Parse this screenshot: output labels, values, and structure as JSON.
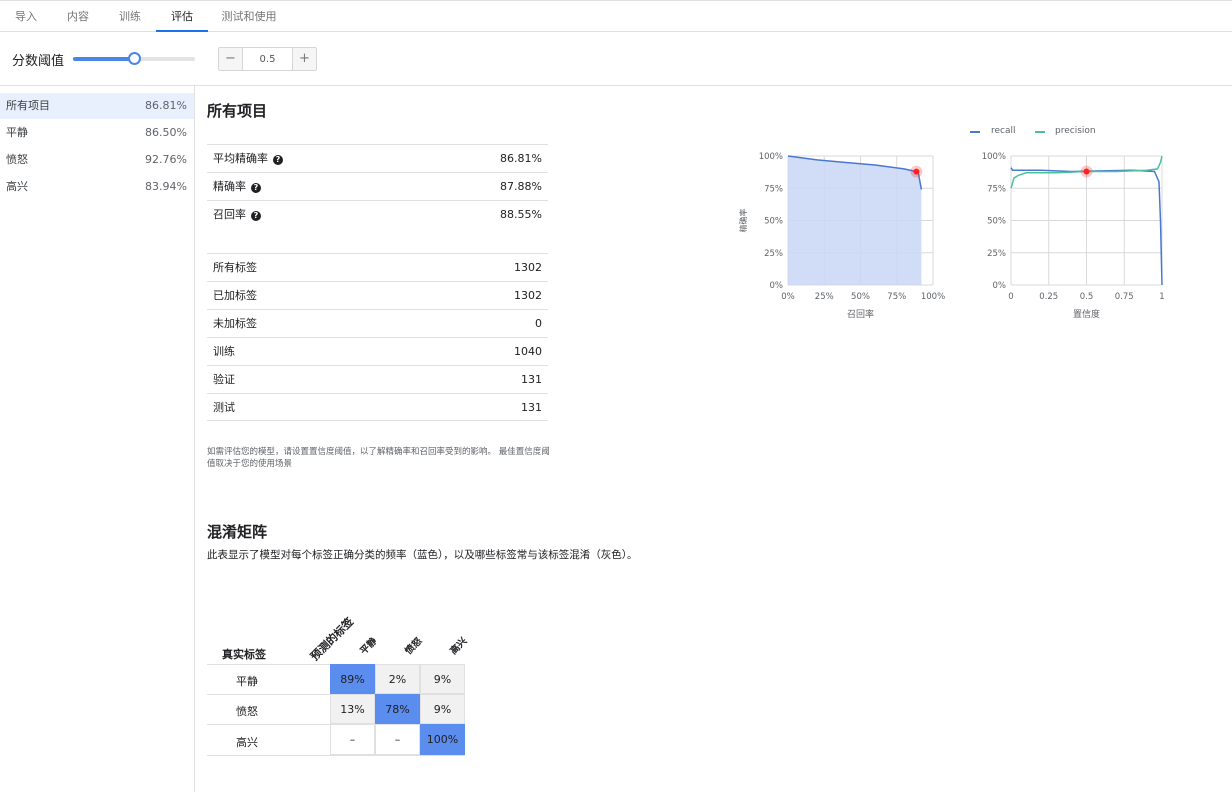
{
  "tabs": [
    {
      "label": "导入",
      "active": false
    },
    {
      "label": "内容",
      "active": false
    },
    {
      "label": "训练",
      "active": false
    },
    {
      "label": "评估",
      "active": true
    },
    {
      "label": "测试和使用",
      "active": false
    }
  ],
  "threshold": {
    "label": "分数阈值",
    "value": "0.5",
    "fraction": 0.5,
    "minus": "−",
    "plus": "+"
  },
  "sidebar": {
    "items": [
      {
        "label": "所有项目",
        "value": "86.81%",
        "selected": true
      },
      {
        "label": "平静",
        "value": "86.50%"
      },
      {
        "label": "愤怒",
        "value": "92.76%"
      },
      {
        "label": "高兴",
        "value": "83.94%"
      }
    ]
  },
  "main": {
    "title": "所有项目",
    "metrics": [
      {
        "label": "平均精确率",
        "value": "86.81%",
        "help": true
      },
      {
        "label": "精确率",
        "value": "87.88%",
        "help": true
      },
      {
        "label": "召回率",
        "value": "88.55%",
        "help": true
      }
    ],
    "counts": [
      {
        "label": "所有标签",
        "value": "1302"
      },
      {
        "label": "已加标签",
        "value": "1302"
      },
      {
        "label": "未加标签",
        "value": "0"
      },
      {
        "label": "训练",
        "value": "1040"
      },
      {
        "label": "验证",
        "value": "131"
      },
      {
        "label": "测试",
        "value": "131"
      }
    ],
    "note": "如需评估您的模型，请设置置信度阈值，以了解精确率和召回率受到的影响。 最佳置信度阈值取决于您的使用场景"
  },
  "confusion_matrix": {
    "title": "混淆矩阵",
    "description": "此表显示了模型对每个标签正确分类的频率（蓝色），以及哪些标签常与该标签混淆（灰色）。",
    "true_label": "真实标签",
    "predicted_label": "预测的标签",
    "columns": [
      "平静",
      "愤怒",
      "高兴"
    ],
    "rows": [
      {
        "label": "平静",
        "cells": [
          "89%",
          "2%",
          "9%"
        ]
      },
      {
        "label": "愤怒",
        "cells": [
          "13%",
          "78%",
          "9%"
        ]
      },
      {
        "label": "高兴",
        "cells": [
          "–",
          "–",
          "100%"
        ]
      }
    ]
  },
  "colors": {
    "recall": "#4a78d0",
    "precision": "#4cc0a0",
    "accent": "#1a73e8",
    "diag": "#5b8def",
    "marker": "#ff2020"
  },
  "chart_data": [
    {
      "type": "area",
      "xlabel": "召回率",
      "ylabel": "精确率",
      "xticks": [
        "0%",
        "25%",
        "50%",
        "75%",
        "100%"
      ],
      "yticks": [
        "0%",
        "25%",
        "50%",
        "75%",
        "100%"
      ],
      "xlim": [
        0,
        1
      ],
      "ylim": [
        0,
        1
      ],
      "grid": true,
      "x": [
        0.0,
        0.2,
        0.4,
        0.6,
        0.8,
        0.88,
        0.9,
        0.91,
        0.92
      ],
      "y": [
        1.0,
        0.97,
        0.95,
        0.93,
        0.9,
        0.88,
        0.86,
        0.8,
        0.74
      ],
      "marker": {
        "x": 0.8855,
        "y": 0.8788
      }
    },
    {
      "type": "line",
      "xlabel": "置信度",
      "xticks": [
        "0",
        "0.25",
        "0.5",
        "0.75",
        "1"
      ],
      "yticks": [
        "0%",
        "25%",
        "50%",
        "75%",
        "100%"
      ],
      "xlim": [
        0,
        1
      ],
      "ylim": [
        0,
        1
      ],
      "grid": true,
      "legend": "top",
      "series": [
        {
          "name": "recall",
          "x": [
            0.0,
            0.01,
            0.05,
            0.2,
            0.4,
            0.6,
            0.8,
            0.95,
            0.98,
            0.99,
            1.0
          ],
          "y": [
            0.91,
            0.89,
            0.89,
            0.89,
            0.88,
            0.885,
            0.89,
            0.88,
            0.8,
            0.5,
            0.0
          ]
        },
        {
          "name": "precision",
          "x": [
            0.0,
            0.02,
            0.05,
            0.1,
            0.3,
            0.5,
            0.7,
            0.9,
            0.97,
            0.99,
            1.0
          ],
          "y": [
            0.75,
            0.83,
            0.85,
            0.87,
            0.87,
            0.88,
            0.88,
            0.89,
            0.9,
            0.95,
            1.0
          ]
        }
      ],
      "marker": {
        "x": 0.5,
        "y": 0.88
      }
    }
  ]
}
